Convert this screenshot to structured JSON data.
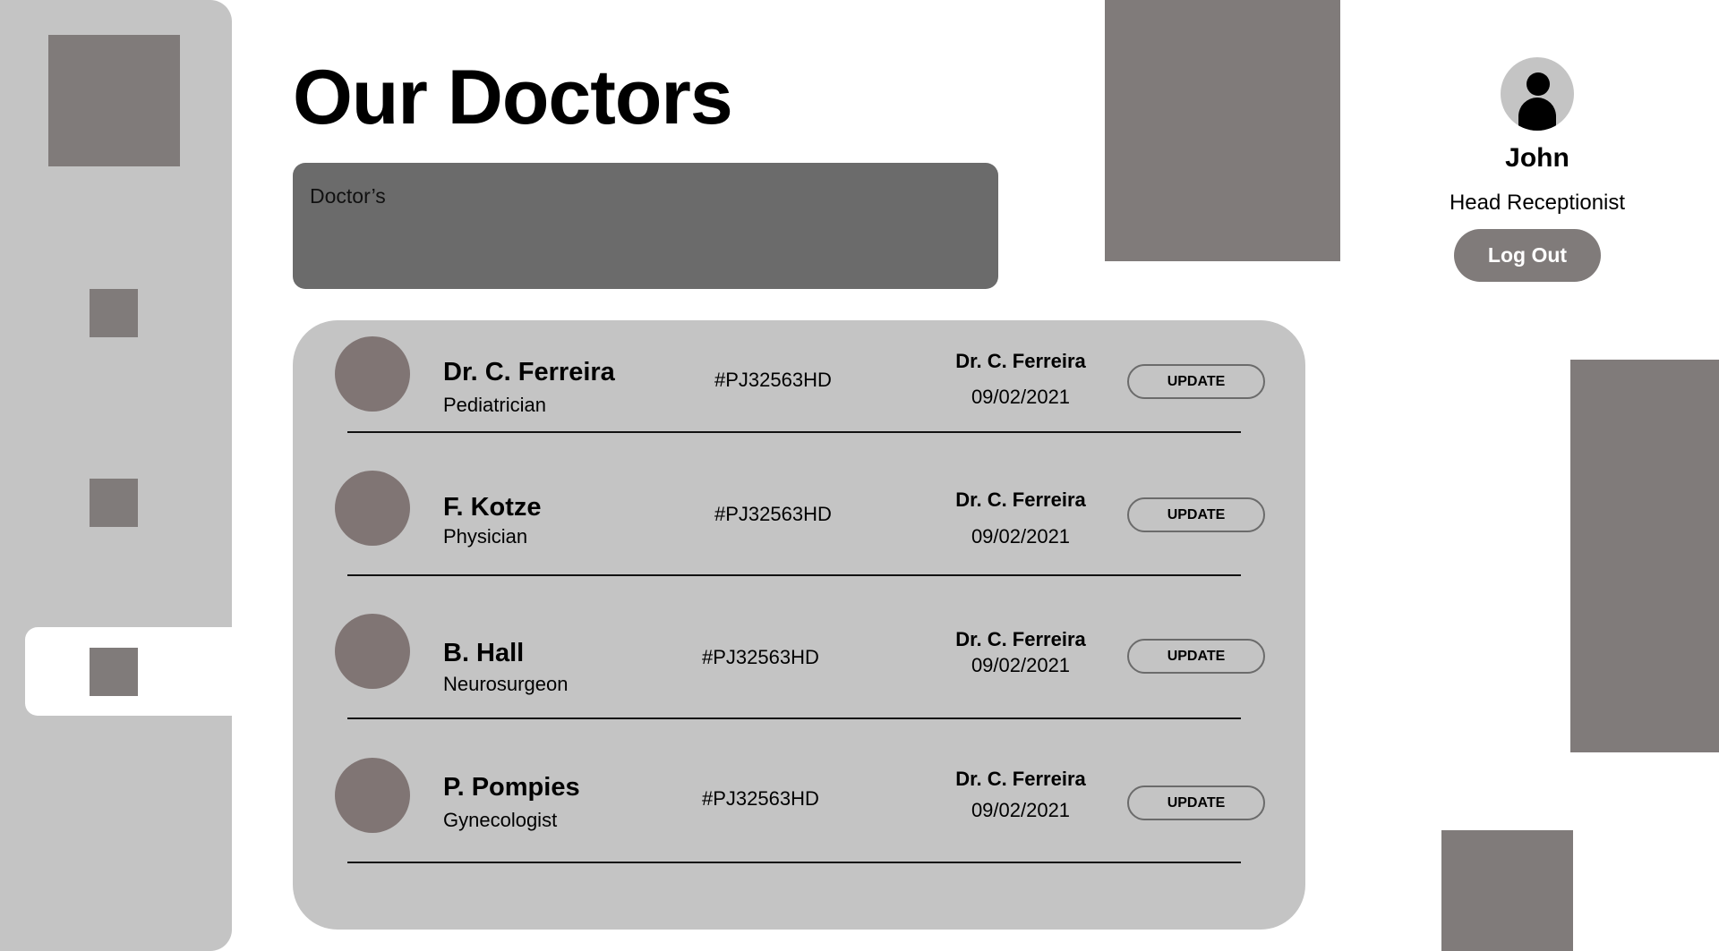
{
  "page": {
    "title": "Our Doctors"
  },
  "sidebar": {
    "items": [
      {
        "name": "logo",
        "active": false
      },
      {
        "name": "nav-item-1",
        "active": false
      },
      {
        "name": "nav-item-2",
        "active": false
      },
      {
        "name": "nav-item-3",
        "active": true
      }
    ]
  },
  "filter": {
    "label": "Doctor’s"
  },
  "profile": {
    "name": "John",
    "role": "Head Receptionist",
    "logout_label": "Log Out",
    "icon": "user-icon"
  },
  "doctors": [
    {
      "name": "Dr. C. Ferreira",
      "specialty": "Pediatrician",
      "id": "#PJ32563HD",
      "assigned_by": "Dr. C. Ferreira",
      "date": "09/02/2021",
      "action": "UPDATE"
    },
    {
      "name": "F. Kotze",
      "specialty": "Physician",
      "id": "#PJ32563HD",
      "assigned_by": "Dr. C. Ferreira",
      "date": "09/02/2021",
      "action": "UPDATE"
    },
    {
      "name": "B. Hall",
      "specialty": "Neurosurgeon",
      "id": "#PJ32563HD",
      "assigned_by": "Dr. C. Ferreira",
      "date": "09/02/2021",
      "action": "UPDATE"
    },
    {
      "name": "P. Pompies",
      "specialty": "Gynecologist",
      "id": "#PJ32563HD",
      "assigned_by": "Dr. C. Ferreira",
      "date": "09/02/2021",
      "action": "UPDATE"
    }
  ],
  "colors": {
    "sidebar_bg": "#c4c4c4",
    "placeholder_block": "#807b7a",
    "filter_bg": "#6b6b6b",
    "card_bg": "#c4c4c4",
    "avatar_placeholder": "#807574"
  }
}
